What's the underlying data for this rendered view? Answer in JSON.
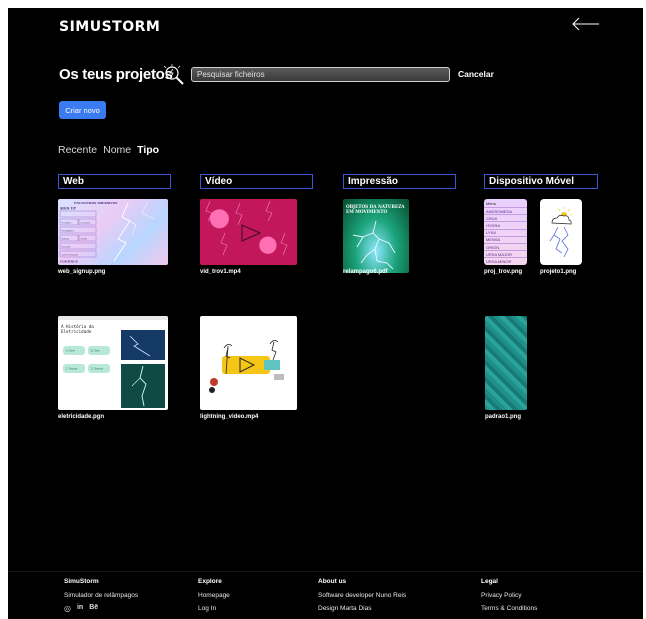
{
  "header": {
    "brand": "SIMUSTORM"
  },
  "projects": {
    "title": "Os teus projetos",
    "search_placeholder": "Pesquisar ficheiros",
    "cancel_label": "Cancelar",
    "create_label": "Criar novo"
  },
  "sort_tabs": [
    {
      "label": "Recente",
      "active": false
    },
    {
      "label": "Nome",
      "active": false
    },
    {
      "label": "Tipo",
      "active": true
    }
  ],
  "categories": [
    "Web",
    "Vídeo",
    "Impressão",
    "Dispositivo Móvel"
  ],
  "files": {
    "web_signup": "web_signup.png",
    "vid_trov1": "vid_trov1.mp4",
    "relampago6": "relampago6.pdf",
    "proj_trov": "proj_trov.png",
    "projeto1": "projeto1.png",
    "eletricidade": "eletricidade.pgn",
    "lightning_video": "lightning_video.mp4",
    "padrao1": "padrao1.png"
  },
  "thumb_text": {
    "web_heading": "ENCONTROS IMERSIVOS",
    "web_signup": "SIGN UP",
    "web_fields": [
      "First Name",
      "Last Name",
      "Email Address",
      "Birthday",
      "Gender",
      "Password",
      "Confirm Password"
    ],
    "web_continue": "CONTINUE",
    "print_title": "OBJETOS DA NATUREZA EM MOVIMENTO",
    "menu_title": "Menu",
    "menu_items": [
      "ANDROMEDA",
      "CRUX",
      "HYDRA",
      "LYNX",
      "MENSA",
      "ORION",
      "URSA MAJOR",
      "URSA MINOR",
      "UT SCUTI"
    ],
    "elec_title": "A História da Eletricidade",
    "elec_items": [
      "A. Cisne",
      "B. Cisne",
      "C. Tesoura",
      "D. Cisnente"
    ]
  },
  "footer": {
    "col1": {
      "heading": "SimuStorm",
      "links": [
        "Simulador de relâmpagos"
      ]
    },
    "col2": {
      "heading": "Explore",
      "links": [
        "Homepage",
        "Log In"
      ]
    },
    "col3": {
      "heading": "About us",
      "links": [
        "Software developer Nuno Reis",
        "Design Marta Dias"
      ]
    },
    "col4": {
      "heading": "Legal",
      "links": [
        "Privacy Policy",
        "Terms & Conditions"
      ]
    },
    "social_icons": [
      "instagram-icon",
      "linkedin-icon",
      "behance-icon"
    ]
  },
  "colors": {
    "background": "#000000",
    "accent": "#3a7bf0",
    "category_border": "#3c56d6"
  }
}
